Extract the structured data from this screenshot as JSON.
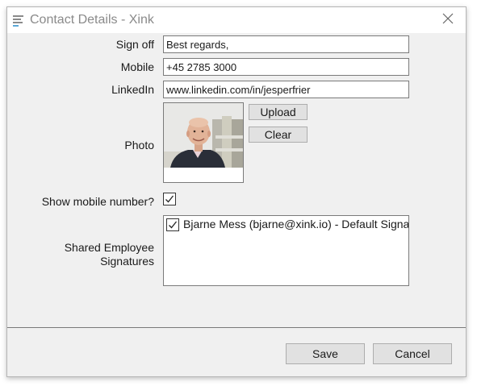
{
  "window": {
    "title": "Contact Details - Xink",
    "app_icon": "menu-lines-icon",
    "close_icon": "close-icon"
  },
  "form": {
    "sign_off": {
      "label": "Sign off",
      "value": "Best regards,"
    },
    "mobile": {
      "label": "Mobile",
      "value": "+45 2785 3000"
    },
    "linkedin": {
      "label": "LinkedIn",
      "value": "www.linkedin.com/in/jesperfrier"
    },
    "photo": {
      "label": "Photo",
      "upload_label": "Upload",
      "clear_label": "Clear"
    },
    "show_mobile": {
      "label": "Show mobile number?",
      "checked": true
    },
    "shared_signatures": {
      "label_line1": "Shared Employee",
      "label_line2": "Signatures",
      "items": [
        {
          "label": "Bjarne Mess (bjarne@xink.io) - Default Signature",
          "checked": true
        }
      ]
    }
  },
  "footer": {
    "save_label": "Save",
    "cancel_label": "Cancel"
  },
  "colors": {
    "window_bg": "#f0f0f0",
    "title_text": "#8a8a8a",
    "accent_icon": "#5aa7d6"
  }
}
